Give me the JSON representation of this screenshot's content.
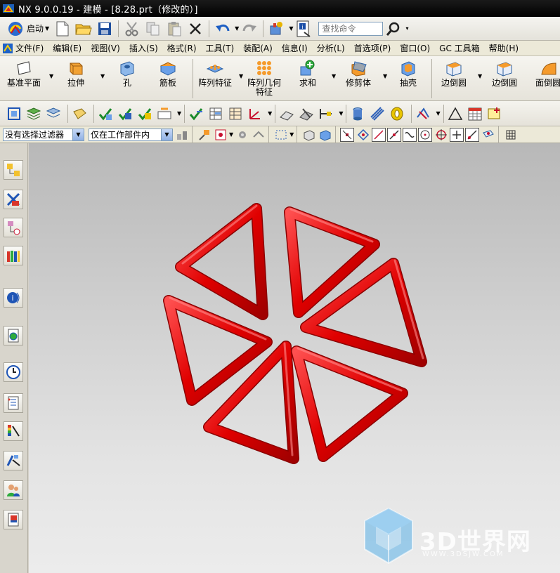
{
  "titlebar": {
    "title": "NX 9.0.0.19 - 建模 - [8.28.prt（修改的）]"
  },
  "toolbar": {
    "start_label": "启动",
    "search_placeholder": "查找命令"
  },
  "menubar": {
    "items": [
      "文件(F)",
      "编辑(E)",
      "视图(V)",
      "插入(S)",
      "格式(R)",
      "工具(T)",
      "装配(A)",
      "信息(I)",
      "分析(L)",
      "首选项(P)",
      "窗口(O)",
      "GC 工具箱",
      "帮助(H)"
    ]
  },
  "features": {
    "items": [
      "基准平面",
      "拉伸",
      "孔",
      "筋板",
      "阵列特征",
      "阵列几何\n特征",
      "求和",
      "修剪体",
      "抽壳",
      "边倒圆",
      "边倒圆",
      "面倒圆"
    ]
  },
  "filterbar": {
    "type_filter": "没有选择过滤器",
    "scope_filter": "仅在工作部件内"
  },
  "watermark": {
    "main": "3D世界网",
    "sub": "WWW.3DSJW.COM"
  },
  "colors": {
    "model": "#e00000",
    "titlebar": "#000000",
    "watermark": "#5ab0e8"
  },
  "icons": {
    "resource_bar": [
      "assembly-navigator-icon",
      "constraint-navigator-icon",
      "part-navigator-icon",
      "reuse-library-icon",
      "hd3d-tools-icon",
      "web-browser-icon",
      "history-icon",
      "process-studio-icon",
      "visualization-icon",
      "manufacturing-wizard-icon",
      "roles-icon",
      "system-scenes-icon"
    ]
  }
}
